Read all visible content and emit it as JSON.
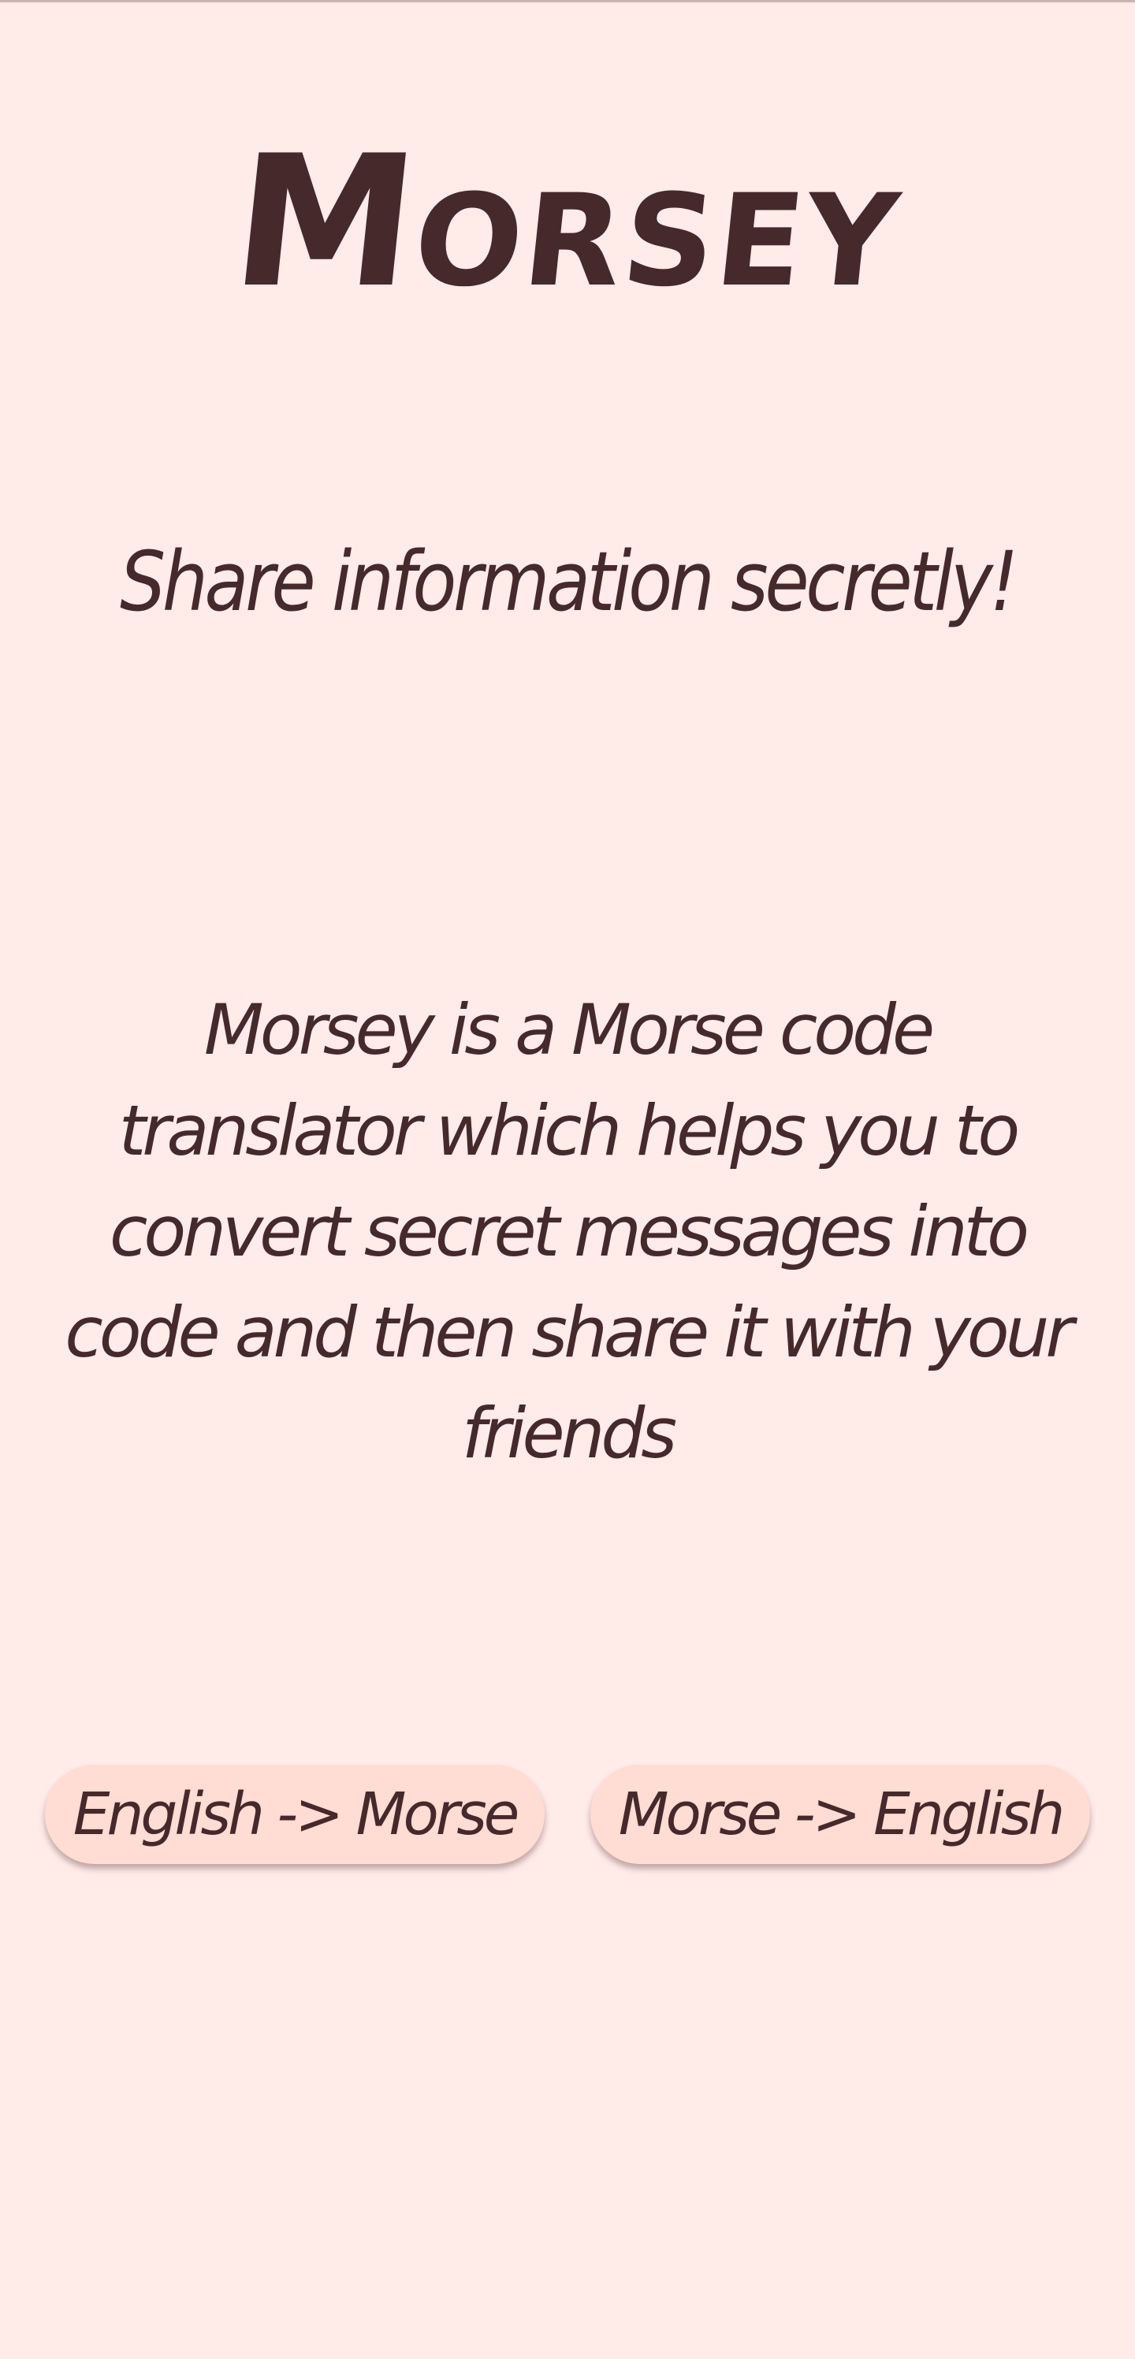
{
  "app": {
    "logo_text": "Morsey",
    "tagline": "Share information secretly!",
    "description": "Morsey is a Morse code translator which helps you to convert secret messages into code and then share it with your friends"
  },
  "buttons": {
    "english_to_morse": "English -> Morse",
    "morse_to_english": "Morse -> English"
  },
  "colors": {
    "background": "#ffebe8",
    "text": "#45292b",
    "button": "#ffdcd4"
  }
}
